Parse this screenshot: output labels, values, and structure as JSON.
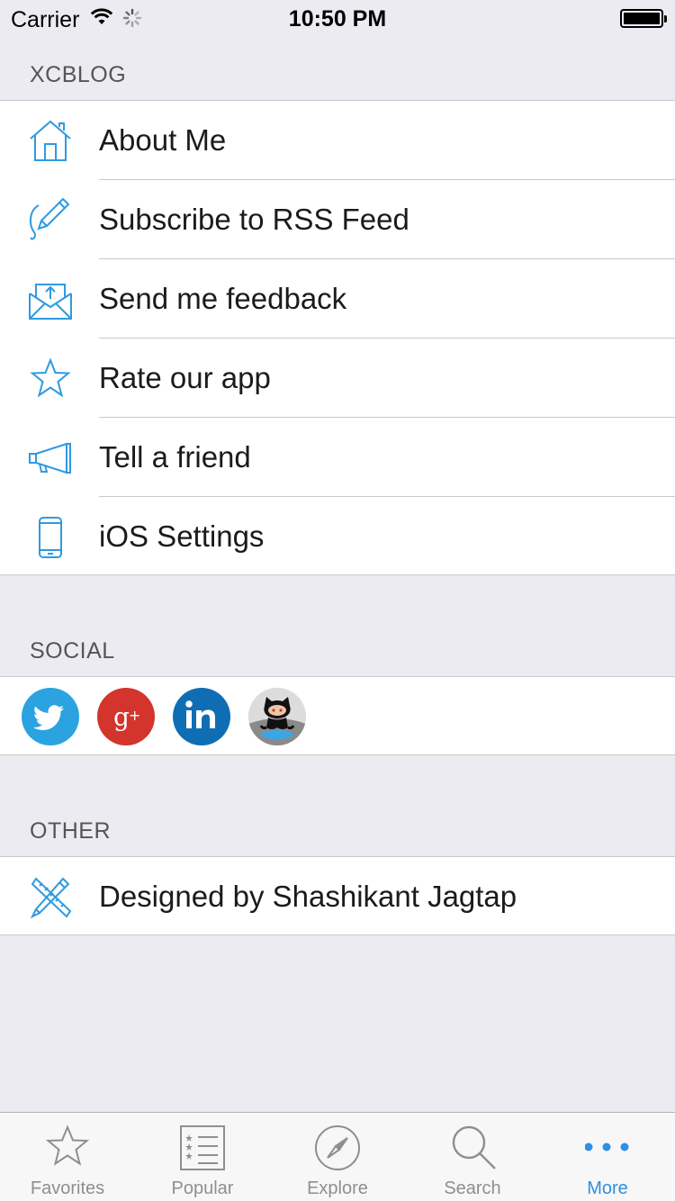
{
  "status": {
    "carrier": "Carrier",
    "time": "10:50 PM"
  },
  "sections": {
    "xcblog": "XCBLOG",
    "social": "SOCIAL",
    "other": "OTHER"
  },
  "menu": {
    "about": "About Me",
    "rss": "Subscribe to RSS Feed",
    "feedback": "Send me feedback",
    "rate": "Rate our app",
    "tell": "Tell a friend",
    "settings": "iOS Settings"
  },
  "social": {
    "twitter_color": "#2aa3e0",
    "google_color": "#d3342b",
    "linkedin_color": "#0f6eb3"
  },
  "other": {
    "designed": "Designed by Shashikant Jagtap"
  },
  "tabs": {
    "favorites": "Favorites",
    "popular": "Popular",
    "explore": "Explore",
    "search": "Search",
    "more": "More"
  },
  "colors": {
    "accent": "#2f8fe0",
    "icon_blue": "#2f9ae0",
    "tab_inactive": "#8e8e93"
  }
}
